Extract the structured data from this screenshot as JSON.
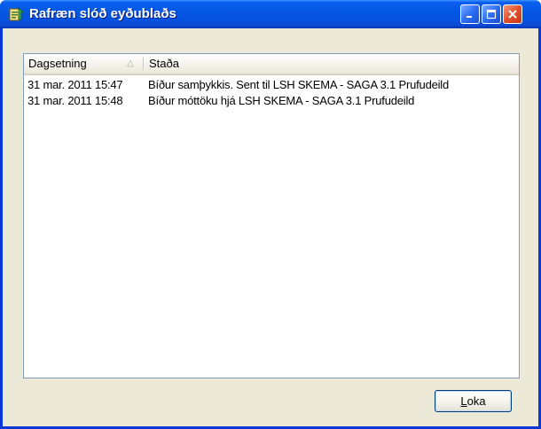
{
  "window": {
    "title": "Rafræn slóð eyðublaðs",
    "colors": {
      "titlebar": "#0458e3",
      "close_button": "#e0522c",
      "frame": "#ece9d8"
    }
  },
  "list": {
    "columns": [
      {
        "label": "Dagsetning",
        "sort": "ascending"
      },
      {
        "label": "Staða"
      }
    ],
    "rows": [
      {
        "date": "31 mar. 2011 15:47",
        "status": "Bíður samþykkis. Sent til LSH SKEMA - SAGA 3.1 Prufudeild"
      },
      {
        "date": "31 mar. 2011 15:48",
        "status": "Bíður móttöku hjá LSH SKEMA - SAGA 3.1 Prufudeild"
      }
    ]
  },
  "footer": {
    "close_label_accel": "L",
    "close_label_rest": "oka"
  },
  "icons": {
    "app": "form-trail-icon",
    "minimize": "minimize-icon",
    "maximize": "maximize-icon",
    "close": "close-icon",
    "sort": "sort-ascending-icon"
  }
}
